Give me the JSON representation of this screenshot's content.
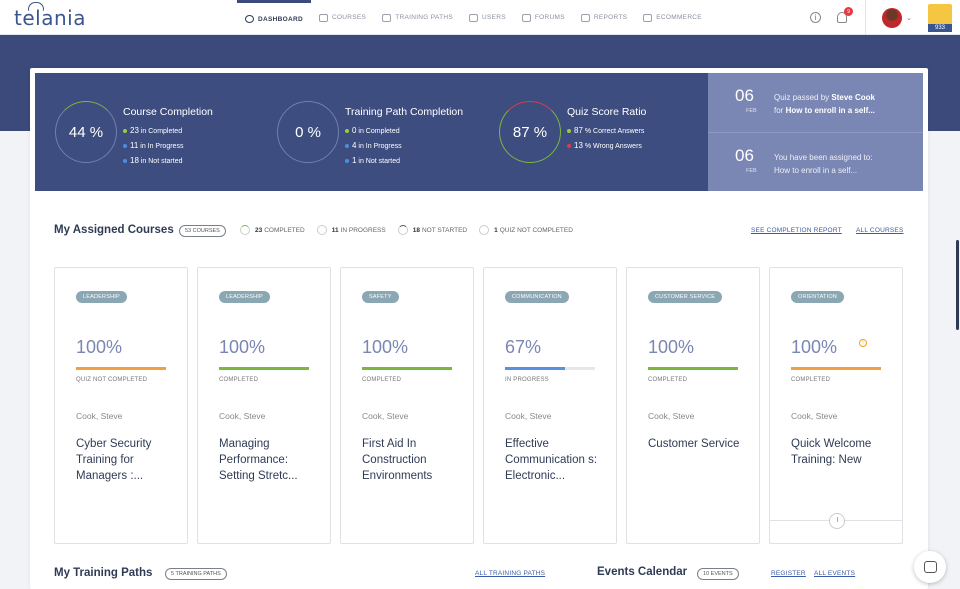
{
  "brand": {
    "logo": "telania"
  },
  "nav": [
    {
      "label": "DASHBOARD",
      "icon": "dashboard-icon",
      "active": true
    },
    {
      "label": "COURSES",
      "icon": "courses-icon"
    },
    {
      "label": "TRAINING PATHS",
      "icon": "training-paths-icon"
    },
    {
      "label": "USERS",
      "icon": "users-icon"
    },
    {
      "label": "FORUMS",
      "icon": "forums-icon"
    },
    {
      "label": "REPORTS",
      "icon": "reports-icon"
    },
    {
      "label": "ECOMMERCE",
      "icon": "ecommerce-icon"
    }
  ],
  "topright": {
    "info": "i",
    "notifications": "9",
    "trophy_count": "933"
  },
  "stats": {
    "course_completion": {
      "title": "Course Completion",
      "value": "44 %",
      "lines": [
        {
          "num": "23",
          "text": " in Completed",
          "color": "#9ccc3c"
        },
        {
          "num": "11",
          "text": " in In Progress",
          "color": "#4a90e2"
        },
        {
          "num": "18",
          "text": " in Not started",
          "color": "#4a90e2"
        }
      ]
    },
    "training_path": {
      "title": "Training Path Completion",
      "value": "0 %",
      "lines": [
        {
          "num": "0",
          "text": " in Completed",
          "color": "#9ccc3c"
        },
        {
          "num": "4",
          "text": " in In Progress",
          "color": "#4a90e2"
        },
        {
          "num": "1",
          "text": " in Not started",
          "color": "#4a90e2"
        }
      ]
    },
    "quiz_score": {
      "title": "Quiz Score Ratio",
      "value": "87 %",
      "lines": [
        {
          "num": "87",
          "text": " % Correct Answers",
          "color": "#9ccc3c"
        },
        {
          "num": "13",
          "text": " % Wrong Answers",
          "color": "#e53945"
        }
      ]
    }
  },
  "notes": [
    {
      "day": "06",
      "month": "FEB",
      "prefix": "Quiz passed by ",
      "bold": "Steve Cook",
      "line2_prefix": "for ",
      "line2_bold": "How to enroll in a self..."
    },
    {
      "day": "06",
      "month": "FEB",
      "line1": "You have been assigned to:",
      "line2": "How to enroll in a self..."
    }
  ],
  "assigned": {
    "title": "My Assigned Courses",
    "count_pill": "53 COURSES",
    "summary": [
      {
        "num": "23",
        "text": "COMPLETED"
      },
      {
        "num": "11",
        "text": "IN PROGRESS"
      },
      {
        "num": "18",
        "text": "NOT STARTED"
      },
      {
        "num": "1",
        "text": "QUIZ NOT COMPLETED"
      }
    ],
    "link_report": "SEE COMPLETION REPORT",
    "link_all": "ALL COURSES"
  },
  "courses": [
    {
      "tag": "LEADERSHIP",
      "pct": "100%",
      "progress": 100,
      "bar_color": "#f0a040",
      "status": "QUIZ NOT COMPLETED",
      "author": "Cook, Steve",
      "title": "Cyber Security Training for Managers :..."
    },
    {
      "tag": "LEADERSHIP",
      "pct": "100%",
      "progress": 100,
      "bar_color": "#7ab83c",
      "status": "COMPLETED",
      "author": "Cook, Steve",
      "title": "Managing Performance: Setting Stretc..."
    },
    {
      "tag": "SAFETY",
      "pct": "100%",
      "progress": 100,
      "bar_color": "#7ab83c",
      "status": "COMPLETED",
      "author": "Cook, Steve",
      "title": "First Aid In Construction Environments"
    },
    {
      "tag": "COMMUNICATION",
      "pct": "67%",
      "progress": 67,
      "bar_color": "#5b8fe0",
      "status": "IN PROGRESS",
      "author": "Cook, Steve",
      "title": "Effective Communication s: Electronic..."
    },
    {
      "tag": "CUSTOMER SERVICE",
      "pct": "100%",
      "progress": 100,
      "bar_color": "#7ab83c",
      "status": "COMPLETED",
      "author": "Cook, Steve",
      "title": "Customer Service"
    },
    {
      "tag": "ORIENTATION",
      "pct": "100%",
      "progress": 100,
      "bar_color": "#f0a040",
      "status": "COMPLETED",
      "author": "Cook, Steve",
      "title": "Quick Welcome Training: New",
      "warn": true
    }
  ],
  "training_paths": {
    "title": "My Training Paths",
    "pill": "5 TRAINING PATHS",
    "link": "ALL TRAINING PATHS"
  },
  "events": {
    "title": "Events Calendar",
    "pill": "10 EVENTS",
    "link_register": "REGISTER",
    "link_all": "ALL EVENTS"
  }
}
